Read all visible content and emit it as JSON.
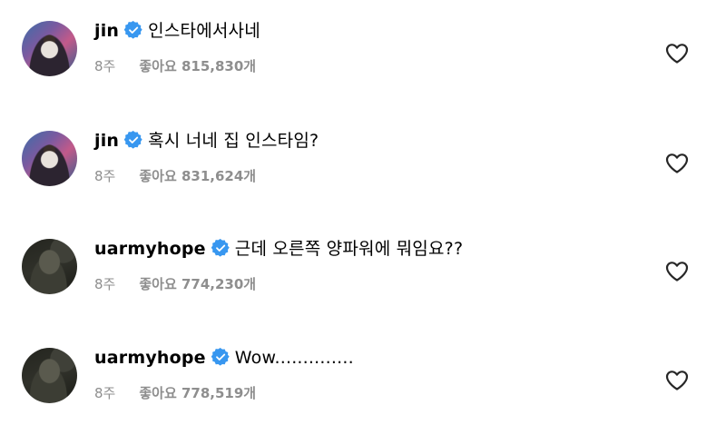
{
  "comments": [
    {
      "username": "jin",
      "text": "인스타에서사네",
      "time": "8주",
      "likes": "좋아요 815,830개",
      "verified": true,
      "avatar_icon": "profile-photo"
    },
    {
      "username": "jin",
      "text": "혹시 너네 집 인스타임?",
      "time": "8주",
      "likes": "좋아요 831,624개",
      "verified": true,
      "avatar_icon": "profile-photo"
    },
    {
      "username": "uarmyhope",
      "text": "근데 오른쪽 양파워에 뭐임요??",
      "time": "8주",
      "likes": "좋아요 774,230개",
      "verified": true,
      "avatar_icon": "profile-photo"
    },
    {
      "username": "uarmyhope",
      "text": "Wow..............",
      "time": "8주",
      "likes": "좋아요 778,519개",
      "verified": true,
      "avatar_icon": "profile-photo"
    }
  ],
  "colors": {
    "verified_blue": "#3897f0",
    "meta_gray": "#8e8e8e",
    "heart_stroke": "#262626"
  },
  "icons": {
    "verified": "verified-badge-icon",
    "like": "heart-outline-icon"
  }
}
